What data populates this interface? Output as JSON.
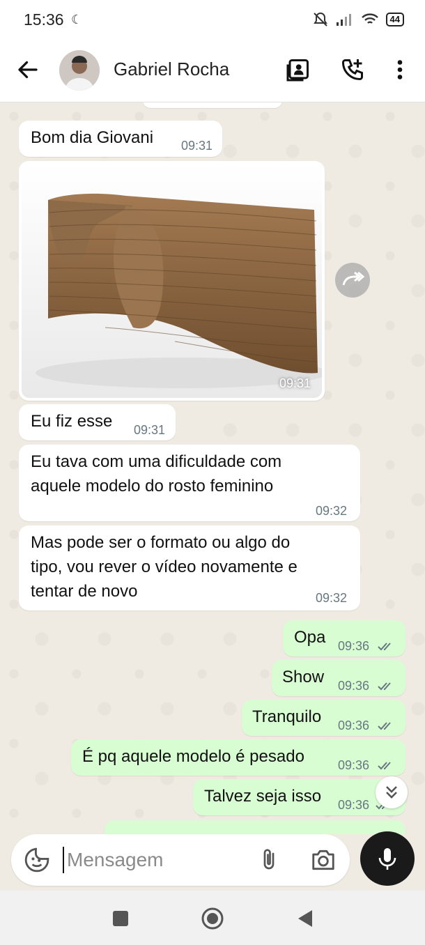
{
  "status_bar": {
    "time": "15:36",
    "battery": "44"
  },
  "header": {
    "contact_name": "Gabriel Rocha"
  },
  "messages": [
    {
      "text": "Bom dia Giovani",
      "time": "09:31",
      "direction": "in"
    },
    {
      "type": "image",
      "time": "09:31",
      "direction": "in"
    },
    {
      "text": "Eu fiz esse",
      "time": "09:31",
      "direction": "in"
    },
    {
      "text": "Eu tava com uma dificuldade com\naquele modelo do rosto feminino",
      "time": "09:32",
      "direction": "in"
    },
    {
      "text": "Mas pode ser o formato ou algo do\ntipo, vou rever o vídeo novamente e\ntentar de novo",
      "time": "09:32",
      "direction": "in"
    },
    {
      "text": "Opa",
      "time": "09:36",
      "direction": "out",
      "status": "read"
    },
    {
      "text": "Show",
      "time": "09:36",
      "direction": "out",
      "status": "read"
    },
    {
      "text": "Tranquilo",
      "time": "09:36",
      "direction": "out",
      "status": "read"
    },
    {
      "text": "É pq aquele modelo é pesado",
      "time": "09:36",
      "direction": "out",
      "status": "read"
    },
    {
      "text": "Talvez seja isso",
      "time": "09:36",
      "direction": "out",
      "status": "read"
    }
  ],
  "composer": {
    "placeholder": "Mensagem"
  },
  "colors": {
    "incoming": "#ffffff",
    "outgoing": "#d9fdd3",
    "background": "#efeae2",
    "tick": "#667781"
  },
  "icons": [
    "back-arrow-icon",
    "contact-photo-icon",
    "add-call-icon",
    "more-vert-icon",
    "forward-icon",
    "double-chevron-down-icon",
    "sticker-icon",
    "attach-icon",
    "camera-icon",
    "mic-icon",
    "stop-icon",
    "home-icon",
    "back-icon",
    "moon-icon",
    "mute-icon",
    "signal-icon",
    "wifi-icon"
  ]
}
